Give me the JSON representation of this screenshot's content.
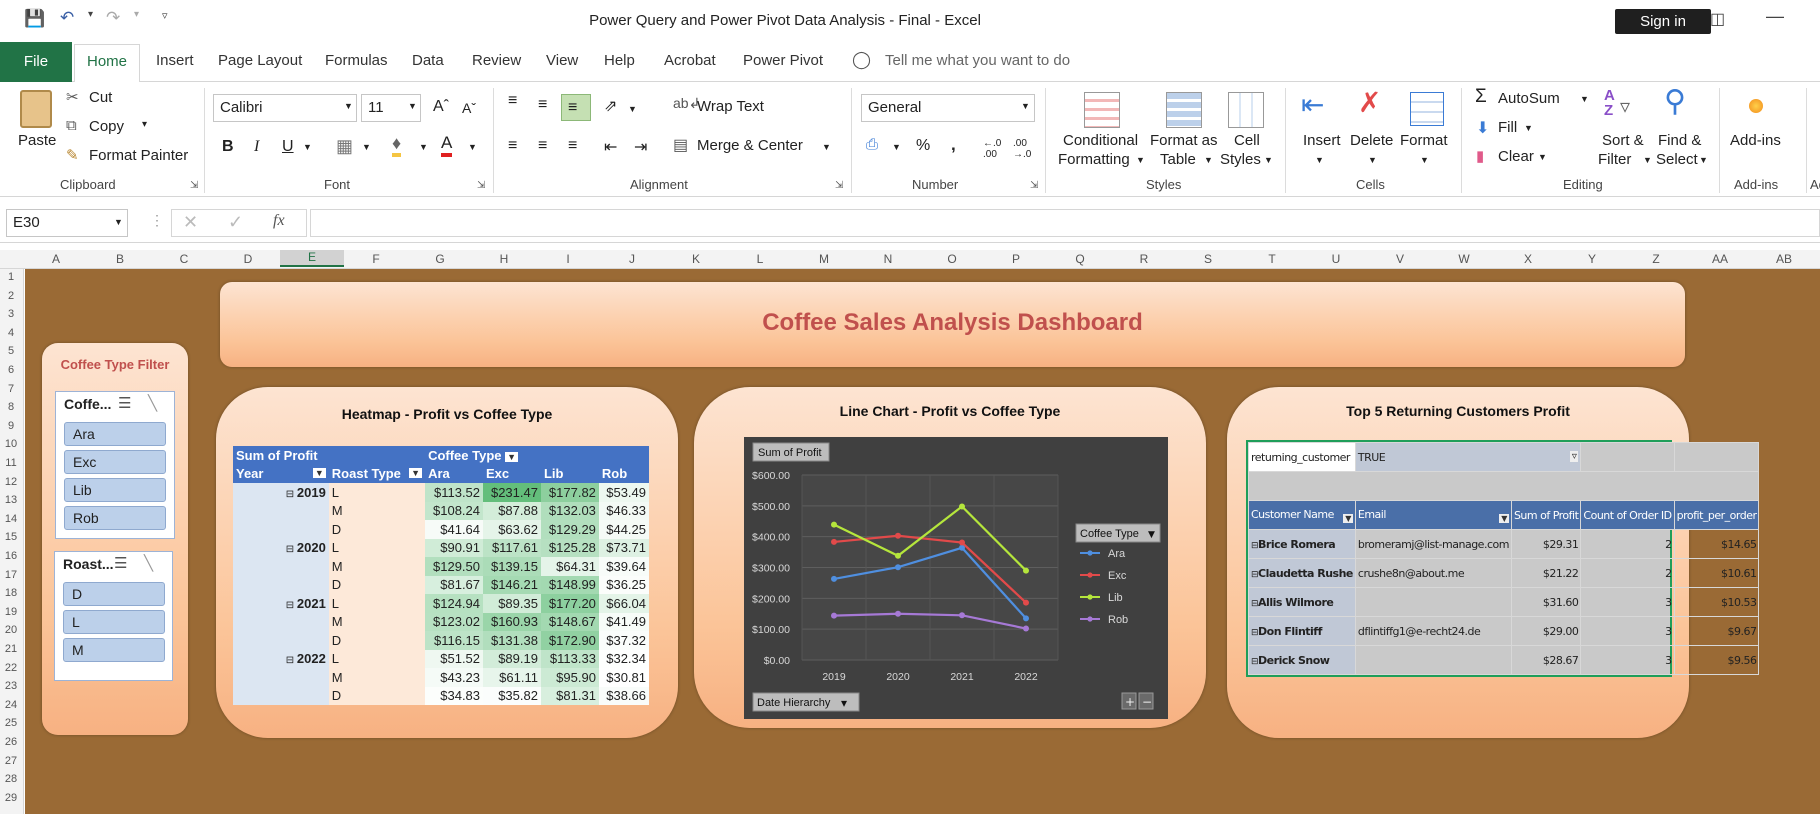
{
  "window": {
    "title": "Power Query and Power Pivot Data Analysis - Final  -  Excel",
    "sign_in": "Sign in"
  },
  "tabs": [
    "File",
    "Home",
    "Insert",
    "Page Layout",
    "Formulas",
    "Data",
    "Review",
    "View",
    "Help",
    "Acrobat",
    "Power Pivot"
  ],
  "tell_me": "Tell me what you want to do",
  "ribbon": {
    "clipboard": {
      "paste": "Paste",
      "cut": "Cut",
      "copy": "Copy",
      "format_painter": "Format Painter",
      "label": "Clipboard"
    },
    "font": {
      "name": "Calibri",
      "size": "11",
      "label": "Font"
    },
    "alignment": {
      "wrap": "Wrap Text",
      "merge": "Merge & Center",
      "label": "Alignment"
    },
    "number": {
      "format": "General",
      "label": "Number"
    },
    "styles": {
      "conditional": "Conditional",
      "formatting": "Formatting",
      "format_as": "Format as",
      "table": "Table",
      "cell": "Cell",
      "cell_styles": "Styles",
      "label": "Styles"
    },
    "cells": {
      "insert": "Insert",
      "delete": "Delete",
      "format": "Format",
      "label": "Cells"
    },
    "editing": {
      "autosum": "AutoSum",
      "fill": "Fill",
      "clear": "Clear",
      "sort": "Sort &",
      "filter": "Filter",
      "find": "Find &",
      "select": "Select",
      "label": "Editing"
    },
    "addins": {
      "button": "Add-ins",
      "label": "Add-ins",
      "cut_label": "Ad"
    }
  },
  "formula_bar": {
    "name_box": "E30",
    "fx": "fx",
    "value": ""
  },
  "columns": [
    "A",
    "B",
    "C",
    "D",
    "E",
    "F",
    "G",
    "H",
    "I",
    "J",
    "K",
    "L",
    "M",
    "N",
    "O",
    "P",
    "Q",
    "R",
    "S",
    "T",
    "U",
    "V",
    "W",
    "X",
    "Y",
    "Z",
    "AA",
    "AB"
  ],
  "rows": [
    "1",
    "2",
    "3",
    "4",
    "5",
    "6",
    "7",
    "8",
    "9",
    "10",
    "11",
    "12",
    "13",
    "14",
    "15",
    "16",
    "17",
    "18",
    "19",
    "20",
    "21",
    "22",
    "23",
    "24",
    "25",
    "26",
    "27",
    "28",
    "29"
  ],
  "dashboard": {
    "title": "Coffee Sales Analysis Dashboard",
    "filter_title": "Coffee Type Filter",
    "slicer_coffee": {
      "header": "Coffe...",
      "items": [
        "Ara",
        "Exc",
        "Lib",
        "Rob"
      ]
    },
    "slicer_roast": {
      "header": "Roast...",
      "items": [
        "D",
        "L",
        "M"
      ]
    },
    "heatmap": {
      "title": "Heatmap - Profit vs Coffee Type",
      "h1": [
        "Sum of Profit",
        "",
        "Coffee Type"
      ],
      "h2": [
        "Year",
        "Roast Type",
        "Ara",
        "Exc",
        "Lib",
        "Rob"
      ],
      "rows": [
        [
          "2019",
          "L",
          "$113.52",
          "$231.47",
          "$177.82",
          "$53.49"
        ],
        [
          "",
          "M",
          "$108.24",
          "$87.88",
          "$132.03",
          "$46.33"
        ],
        [
          "",
          "D",
          "$41.64",
          "$63.62",
          "$129.29",
          "$44.25"
        ],
        [
          "2020",
          "L",
          "$90.91",
          "$117.61",
          "$125.28",
          "$73.71"
        ],
        [
          "",
          "M",
          "$129.50",
          "$139.15",
          "$64.31",
          "$39.64"
        ],
        [
          "",
          "D",
          "$81.67",
          "$146.21",
          "$148.99",
          "$36.25"
        ],
        [
          "2021",
          "L",
          "$124.94",
          "$89.35",
          "$177.20",
          "$66.04"
        ],
        [
          "",
          "M",
          "$123.02",
          "$160.93",
          "$148.67",
          "$41.49"
        ],
        [
          "",
          "D",
          "$116.15",
          "$131.38",
          "$172.90",
          "$37.32"
        ],
        [
          "2022",
          "L",
          "$51.52",
          "$89.19",
          "$113.33",
          "$32.34"
        ],
        [
          "",
          "M",
          "$43.23",
          "$61.11",
          "$95.90",
          "$30.81"
        ],
        [
          "",
          "D",
          "$34.83",
          "$35.82",
          "$81.31",
          "$38.66"
        ]
      ]
    },
    "line_chart_title": "Line Chart - Profit vs Coffee Type",
    "chart_ui": {
      "sum_btn": "Sum of Profit",
      "legend_title": "Coffee Type",
      "date_btn": "Date Hierarchy",
      "plus": "+",
      "minus": "−"
    },
    "top5": {
      "title": "Top 5 Returning Customers Profit",
      "filter_field": "returning_customer",
      "filter_value": "TRUE",
      "headers": [
        "Customer Name",
        "Email",
        "Sum of Profit",
        "Count of Order ID",
        "profit_per_order"
      ],
      "rows": [
        [
          "Brice Romera",
          "bromeramj@list-manage.com",
          "$29.31",
          "2",
          "$14.65"
        ],
        [
          "Claudetta Rushe",
          "crushe8n@about.me",
          "$21.22",
          "2",
          "$10.61"
        ],
        [
          "Allis Wilmore",
          "",
          "$31.60",
          "3",
          "$10.53"
        ],
        [
          "Don Flintiff",
          "dflintiffg1@e-recht24.de",
          "$29.00",
          "3",
          "$9.67"
        ],
        [
          "Derick Snow",
          "",
          "$28.67",
          "3",
          "$9.56"
        ]
      ]
    }
  },
  "chart_data": {
    "type": "line",
    "title": "",
    "categories": [
      "2019",
      "2020",
      "2021",
      "2022"
    ],
    "ylim": [
      0,
      600
    ],
    "yticks": [
      "$0.00",
      "$100.00",
      "$200.00",
      "$300.00",
      "$400.00",
      "$500.00",
      "$600.00"
    ],
    "grid": true,
    "legend": "right",
    "series": [
      {
        "name": "Ara",
        "color": "#4f8fe0",
        "values": [
          263,
          301,
          364,
          135
        ]
      },
      {
        "name": "Exc",
        "color": "#e24a4a",
        "values": [
          383,
          403,
          381,
          186
        ]
      },
      {
        "name": "Lib",
        "color": "#b5e63c",
        "values": [
          439,
          338,
          498,
          290
        ]
      },
      {
        "name": "Rob",
        "color": "#a679d6",
        "values": [
          144,
          150,
          145,
          102
        ]
      }
    ]
  }
}
